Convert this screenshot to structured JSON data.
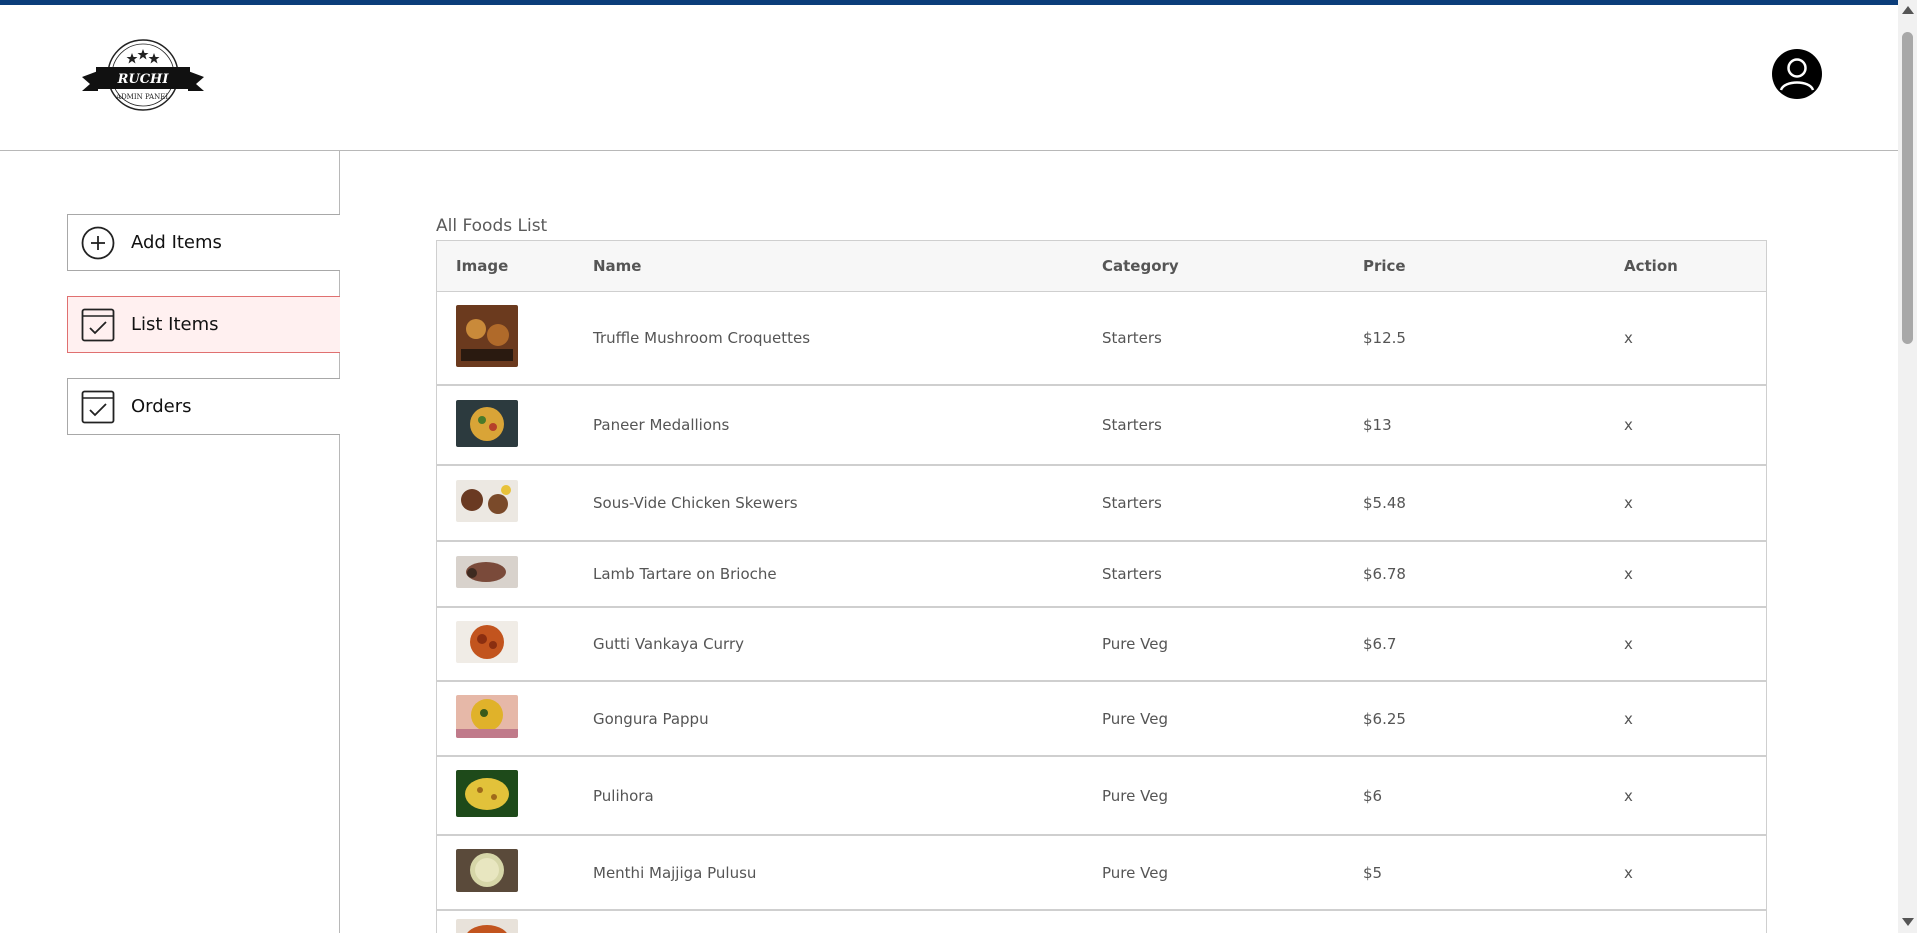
{
  "colors": {
    "topbar": "#0b3d7a",
    "active_bg": "#fff0f0",
    "active_border": "#e07070"
  },
  "logo": {
    "brand": "RUCHI",
    "subtitle": "ADMIN PANEL",
    "icon": "restaurant-logo"
  },
  "profile": {
    "icon": "user-profile-icon"
  },
  "sidebar": {
    "items": [
      {
        "label": "Add Items",
        "icon": "plus-circle-icon",
        "active": false
      },
      {
        "label": "List Items",
        "icon": "checkbox-icon",
        "active": true
      },
      {
        "label": "Orders",
        "icon": "checkbox-icon",
        "active": false
      }
    ]
  },
  "main": {
    "title": "All Foods List",
    "columns": [
      "Image",
      "Name",
      "Category",
      "Price",
      "Action"
    ],
    "rows": [
      {
        "name": "Truffle Mushroom Croquettes",
        "category": "Starters",
        "price": "$12.5",
        "action": "x"
      },
      {
        "name": "Paneer Medallions",
        "category": "Starters",
        "price": "$13",
        "action": "x"
      },
      {
        "name": "Sous-Vide Chicken Skewers",
        "category": "Starters",
        "price": "$5.48",
        "action": "x"
      },
      {
        "name": "Lamb Tartare on Brioche",
        "category": "Starters",
        "price": "$6.78",
        "action": "x"
      },
      {
        "name": "Gutti Vankaya Curry",
        "category": "Pure Veg",
        "price": "$6.7",
        "action": "x"
      },
      {
        "name": "Gongura Pappu",
        "category": "Pure Veg",
        "price": "$6.25",
        "action": "x"
      },
      {
        "name": "Pulihora",
        "category": "Pure Veg",
        "price": "$6",
        "action": "x"
      },
      {
        "name": "Menthi Majjiga Pulusu",
        "category": "Pure Veg",
        "price": "$5",
        "action": "x"
      }
    ]
  }
}
